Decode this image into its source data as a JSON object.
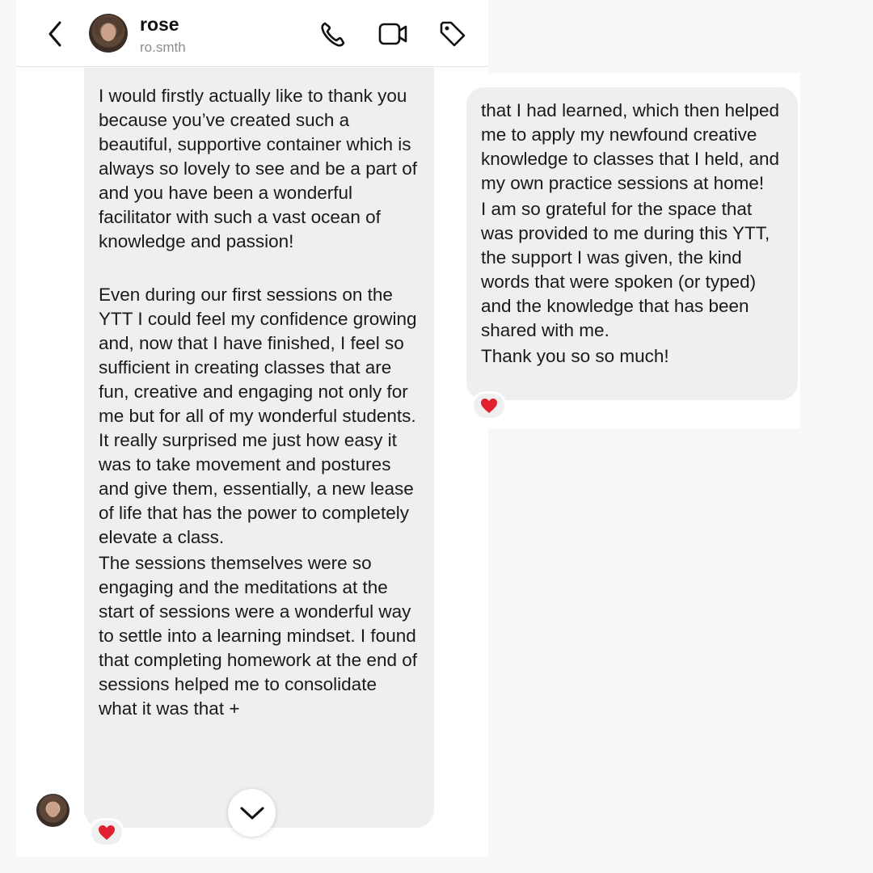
{
  "header": {
    "name": "rose",
    "handle": "ro.smth"
  },
  "icons": {
    "back": "chevron-left-icon",
    "phone": "phone-icon",
    "video": "video-camera-icon",
    "tag": "tag-icon",
    "scroll": "chevron-down-icon",
    "reaction": "heart-icon"
  },
  "colors": {
    "bubble": "#efefef",
    "heart": "#e0202e",
    "secondary_text": "#8e8e8e"
  },
  "messages": {
    "left": {
      "paragraphs": [
        "I would firstly actually like to thank you because you’ve created such a beautiful, supportive container which is always so lovely to see and be a part of and you have been a wonderful facilitator with such a vast ocean of knowledge and passion!",
        "Even during our first sessions on the YTT I could feel my confidence growing and, now that I have finished, I feel so sufficient in creating classes that are fun, creative and engaging not only for me but for all of my wonderful students. It really surprised me just how easy it was to take movement and postures and give them, essentially, a new lease of life that has the power to completely elevate a class.",
        "The sessions themselves were so engaging and the meditations at the start of sessions were a wonderful way to settle into a learning mindset. I found that completing homework at the end of sessions helped me to consolidate what it was that +"
      ],
      "reaction": "❤️"
    },
    "right": {
      "paragraphs": [
        "that I had learned, which then helped me to apply my newfound creative knowledge to classes that I held, and my own practice sessions at home!",
        "I am so grateful for the space that was provided to me during this YTT, the support I was given, the kind words that were spoken (or typed) and the knowledge that has been shared with me.",
        "Thank you so so much!"
      ],
      "reaction": "❤️"
    }
  }
}
